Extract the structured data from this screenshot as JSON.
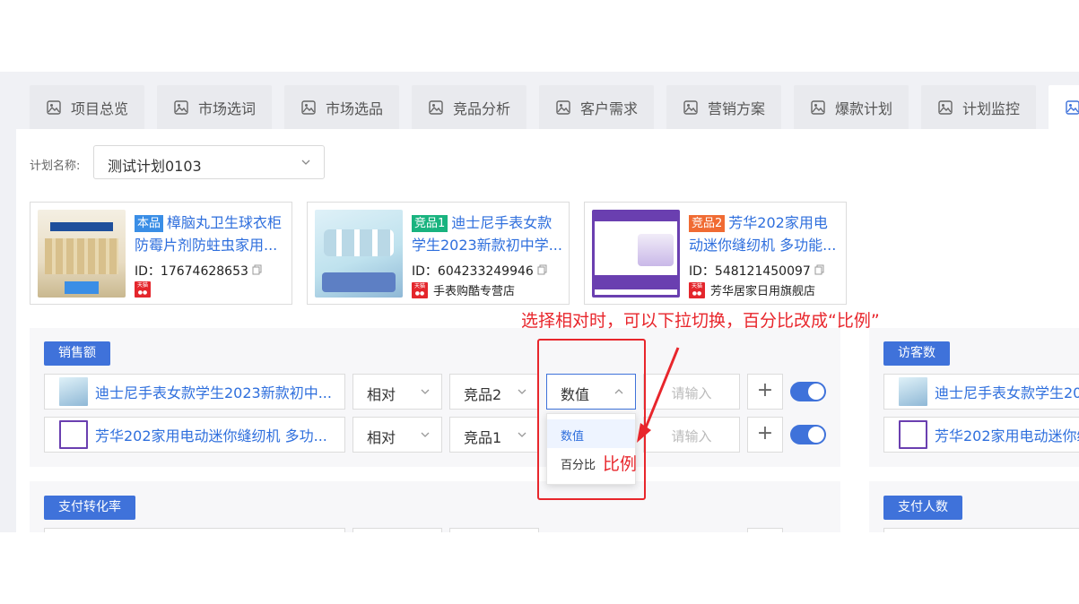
{
  "tabs": [
    {
      "label": "项目总览"
    },
    {
      "label": "市场选词"
    },
    {
      "label": "市场选品"
    },
    {
      "label": "竞品分析"
    },
    {
      "label": "客户需求"
    },
    {
      "label": "营销方案"
    },
    {
      "label": "爆款计划"
    },
    {
      "label": "计划监控"
    }
  ],
  "plan": {
    "label": "计划名称:",
    "value": "测试计划0103"
  },
  "products": [
    {
      "badge": "本品",
      "badge_color": "#3a8ee6",
      "title": "樟脑丸卫生球衣柜防霉片剂防蛀虫家用...",
      "id": "ID：17674628653",
      "store": ""
    },
    {
      "badge": "竞品1",
      "badge_color": "#19b37f",
      "title": "迪士尼手表女款学生2023新款初中学...",
      "id": "ID：604233249946",
      "store": "手表购酷专营店"
    },
    {
      "badge": "竞品2",
      "badge_color": "#f06b33",
      "title": "芳华202家用电动迷你缝纫机 多功能...",
      "id": "ID：548121450097",
      "store": "芳华居家日用旗舰店"
    }
  ],
  "metrics": {
    "sales": "销售额",
    "visitors": "访客数",
    "conversion": "支付转化率",
    "payers": "支付人数"
  },
  "rows": [
    {
      "product": "迪士尼手表女款学生2023新款初中...",
      "mode": "相对",
      "target": "竞品2",
      "type": "数值",
      "input_placeholder": "请输入"
    },
    {
      "product": "芳华202家用电动迷你缝纫机 多功...",
      "mode": "相对",
      "target": "竞品1",
      "type": "",
      "input_placeholder": "请输入"
    }
  ],
  "right_rows": [
    {
      "product": "迪士尼手表女款学生20"
    },
    {
      "product": "芳华202家用电动迷你缝"
    }
  ],
  "dropdown_options": [
    "数值",
    "百分比"
  ],
  "annotation": {
    "text": "选择相对时，可以下拉切换，百分比改成“比例”",
    "ratio": "比例",
    "color": "#e8262c"
  },
  "colors": {
    "accent": "#3f72da",
    "link": "#2f6fdd"
  }
}
